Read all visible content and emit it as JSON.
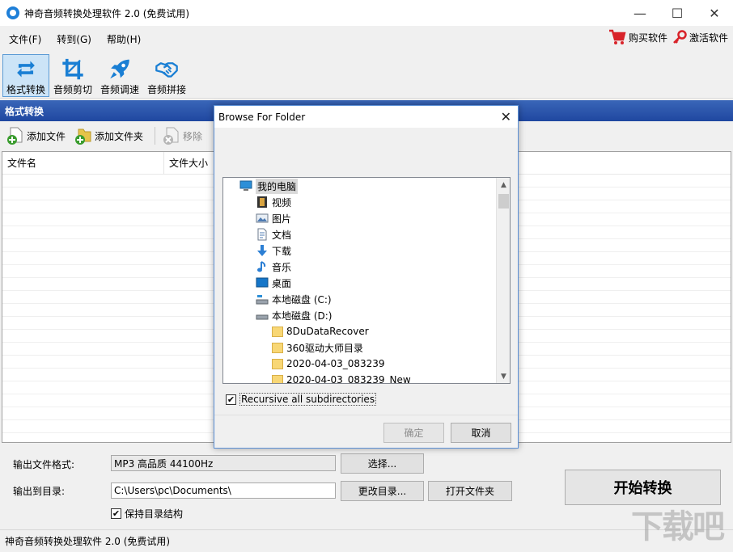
{
  "window": {
    "title": "神奇音频转换处理软件 2.0 (免费试用)",
    "min_glyph": "—",
    "max_glyph": "☐",
    "close_glyph": "✕"
  },
  "menu": {
    "items": [
      "文件(F)",
      "转到(G)",
      "帮助(H)"
    ],
    "buy_label": "购买软件",
    "activate_label": "激活软件"
  },
  "toolbar": {
    "tools": [
      {
        "label": "格式转换",
        "icon": "convert-icon",
        "active": true
      },
      {
        "label": "音频剪切",
        "icon": "crop-icon",
        "active": false
      },
      {
        "label": "音频调速",
        "icon": "rocket-icon",
        "active": false
      },
      {
        "label": "音频拼接",
        "icon": "handshake-icon",
        "active": false
      }
    ]
  },
  "section": {
    "title": "格式转换"
  },
  "filebar": {
    "add_file": "添加文件",
    "add_folder": "添加文件夹",
    "remove": "移除"
  },
  "filelist": {
    "columns": [
      "文件名",
      "文件大小"
    ]
  },
  "bottom": {
    "format_label": "输出文件格式:",
    "format_value": "MP3 高品质 44100Hz",
    "select_button": "选择...",
    "output_label": "输出到目录:",
    "output_value": "C:\\Users\\pc\\Documents\\",
    "change_dir_button": "更改目录...",
    "open_folder_button": "打开文件夹",
    "keep_structure_label": "保持目录结构",
    "keep_structure_checked": true,
    "start_button": "开始转换"
  },
  "status": {
    "text": "神奇音频转换处理软件 2.0 (免费试用)"
  },
  "dialog": {
    "title": "Browse For Folder",
    "close_glyph": "✕",
    "tree": [
      {
        "label": "我的电脑",
        "icon": "computer-icon",
        "level": 0,
        "selected": true
      },
      {
        "label": "视频",
        "icon": "video-icon",
        "level": 1
      },
      {
        "label": "图片",
        "icon": "picture-icon",
        "level": 1
      },
      {
        "label": "文档",
        "icon": "document-icon",
        "level": 1
      },
      {
        "label": "下载",
        "icon": "download-icon",
        "level": 1
      },
      {
        "label": "音乐",
        "icon": "music-icon",
        "level": 1
      },
      {
        "label": "桌面",
        "icon": "desktop-icon",
        "level": 1
      },
      {
        "label": "本地磁盘 (C:)",
        "icon": "drive-icon",
        "level": 1
      },
      {
        "label": "本地磁盘 (D:)",
        "icon": "drive-icon",
        "level": 1
      },
      {
        "label": "8DuDataRecover",
        "icon": "folder-icon",
        "level": 2
      },
      {
        "label": "360驱动大师目录",
        "icon": "folder-icon",
        "level": 2
      },
      {
        "label": "2020-04-03_083239",
        "icon": "folder-icon",
        "level": 2
      },
      {
        "label": "2020-04-03_083239_New",
        "icon": "folder-icon",
        "level": 2
      }
    ],
    "recursive_label": "Recursive all subdirectories",
    "recursive_checked": true,
    "ok_button": "确定",
    "cancel_button": "取消"
  },
  "watermark": "下载吧"
}
